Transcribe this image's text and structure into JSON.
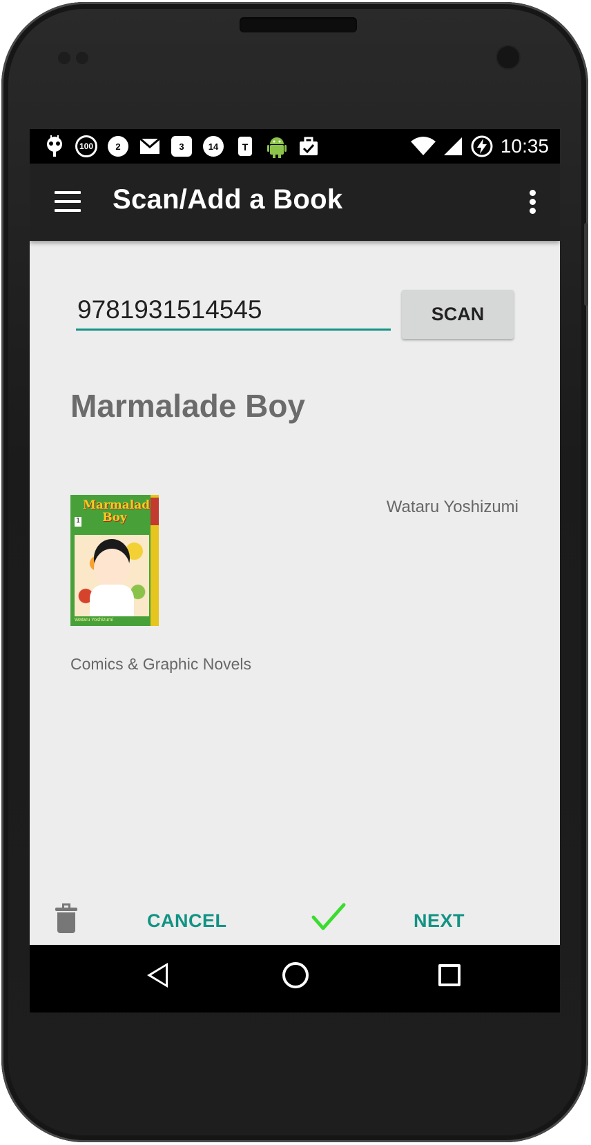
{
  "status_bar": {
    "notification_icons": [
      "cyanogenmod-icon",
      "100",
      "2",
      "gmail-icon",
      "3",
      "14",
      "tmobile-icon",
      "android-icon",
      "briefcase-check-icon"
    ],
    "time": "10:35"
  },
  "app_bar": {
    "title": "Scan/Add a Book"
  },
  "form": {
    "isbn_value": "9781931514545",
    "scan_label": "SCAN"
  },
  "book": {
    "title": "Marmalade Boy",
    "author": "Wataru Yoshizumi",
    "category": "Comics & Graphic Novels",
    "cover_title_text": "Marmalade Boy",
    "cover_volume": "1",
    "cover_author_text": "Wataru Yoshizumi"
  },
  "actions": {
    "cancel_label": "CANCEL",
    "next_label": "NEXT"
  },
  "colors": {
    "accent": "#119384",
    "check": "#3bdc2f",
    "app_bar": "#212121",
    "content_bg": "#ededed"
  }
}
